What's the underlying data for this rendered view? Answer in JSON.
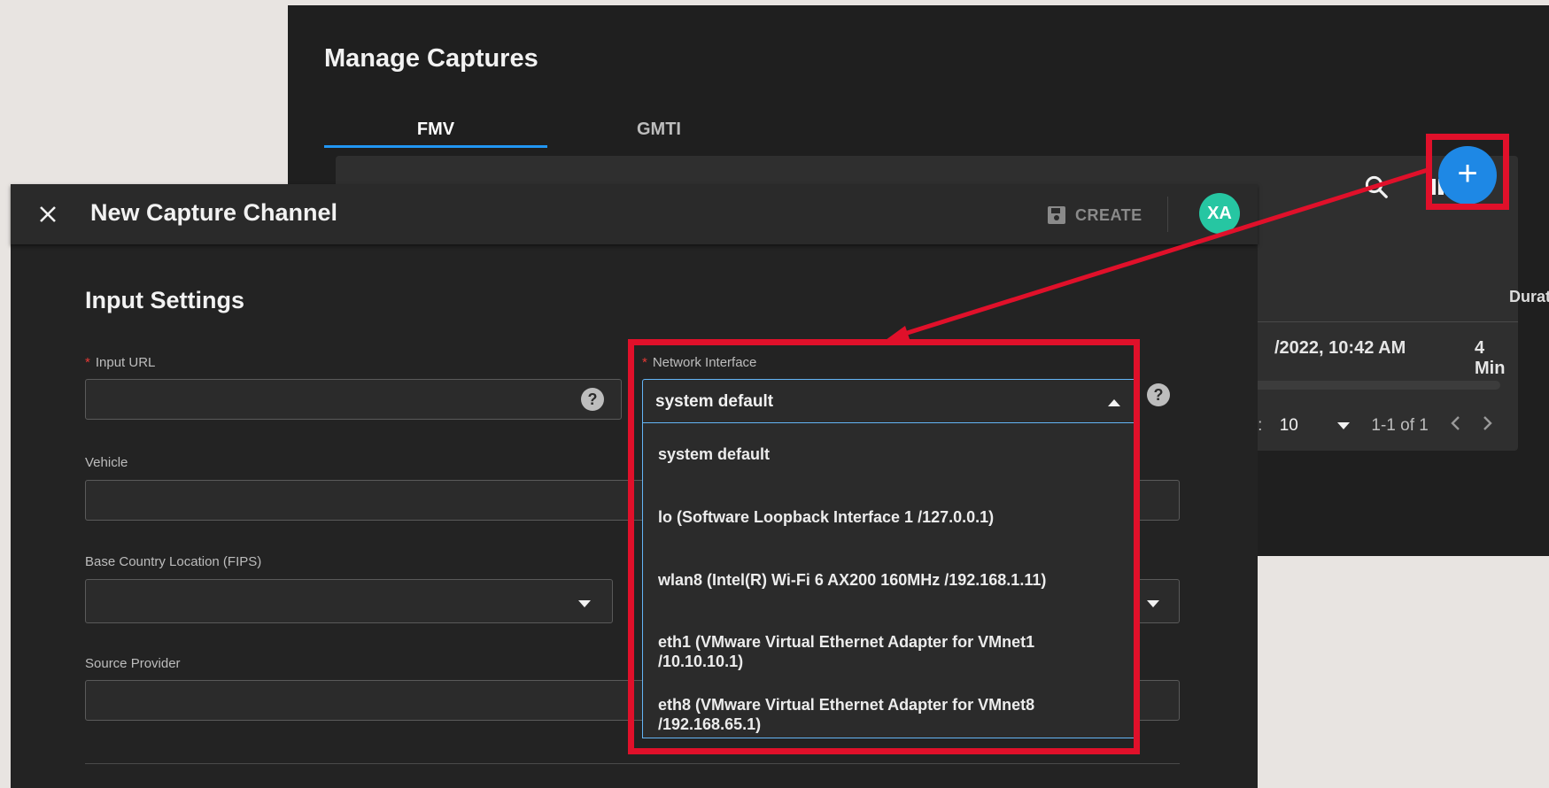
{
  "background_window": {
    "title": "Manage Captures",
    "tabs": [
      {
        "label": "FMV",
        "active": true
      },
      {
        "label": "GMTI",
        "active": false
      }
    ],
    "table": {
      "columns": [
        "Duratio"
      ],
      "rows": [
        {
          "date_fragment": "/2022, 10:42 AM",
          "duration": "4 Min"
        }
      ],
      "pagination": {
        "rows_per_page_label": "ge:",
        "rows_per_page_value": "10",
        "range": "1-1 of 1"
      }
    },
    "fab": {
      "label": "+",
      "icon": "plus-icon",
      "color": "#1e88e5"
    }
  },
  "dialog": {
    "title": "New Capture Channel",
    "create_label": "CREATE",
    "avatar_initials": "XA",
    "avatar_color": "#26c6a2",
    "section_title": "Input Settings",
    "fields": {
      "input_url": {
        "label": "Input URL",
        "required": true,
        "value": ""
      },
      "network_interface": {
        "label": "Network Interface",
        "required": true,
        "value": "system default",
        "options": [
          "system default",
          "lo (Software Loopback Interface 1 /127.0.0.1)",
          "wlan8 (Intel(R) Wi-Fi 6 AX200 160MHz /192.168.1.11)",
          "eth1 (VMware Virtual Ethernet Adapter for VMnet1 /10.10.10.1)",
          "eth8 (VMware Virtual Ethernet Adapter for VMnet8 /192.168.65.1)"
        ]
      },
      "vehicle": {
        "label": "Vehicle",
        "value": ""
      },
      "base_country": {
        "label": "Base Country Location (FIPS)",
        "value": ""
      },
      "source_provider": {
        "label": "Source Provider",
        "value": ""
      }
    }
  },
  "annotation": {
    "color": "#e0102a"
  }
}
